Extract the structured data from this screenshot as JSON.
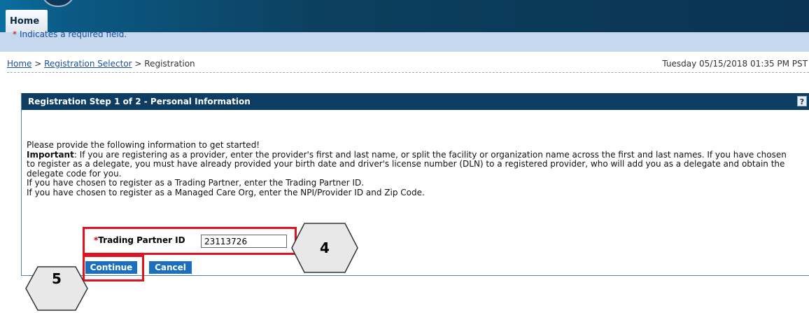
{
  "nav": {
    "home_tab": "Home"
  },
  "breadcrumb": {
    "home": "Home",
    "sep1": " > ",
    "selector": "Registration Selector",
    "sep2": " > ",
    "current": "Registration"
  },
  "datetime": "Tuesday 05/15/2018 01:35 PM PST",
  "panel": {
    "title": "Registration Step 1 of 2 - Personal Information",
    "help_icon": "?"
  },
  "required_note": {
    "star": "*",
    "text": "Indicates a required field."
  },
  "instructions": {
    "line1": "Please provide the following information to get started!",
    "important_label": "Important",
    "important_text": ": If you are registering as a provider, enter the provider's first and last name, or split the facility or organization name across the first and last names. If you have chosen to register as a delegate, you must have already provided your birth date and driver's license number (DLN) to a registered provider, who will add you as a delegate and obtain the delegate code for you.",
    "trading_partner": "If you have chosen to register as a Trading Partner, enter the Trading Partner ID.",
    "managed_care": "If you have chosen to register as a Managed Care Org, enter the NPI/Provider ID and Zip Code."
  },
  "form": {
    "star": "*",
    "label": "Trading Partner ID",
    "value": "23113726"
  },
  "buttons": {
    "continue": "Continue",
    "cancel": "Cancel"
  },
  "callouts": {
    "step4": "4",
    "step5": "5"
  },
  "colors": {
    "header": "#0d3d63",
    "highlight": "#e0141e",
    "button": "#1a6fbf",
    "link": "#1a4f9c"
  }
}
